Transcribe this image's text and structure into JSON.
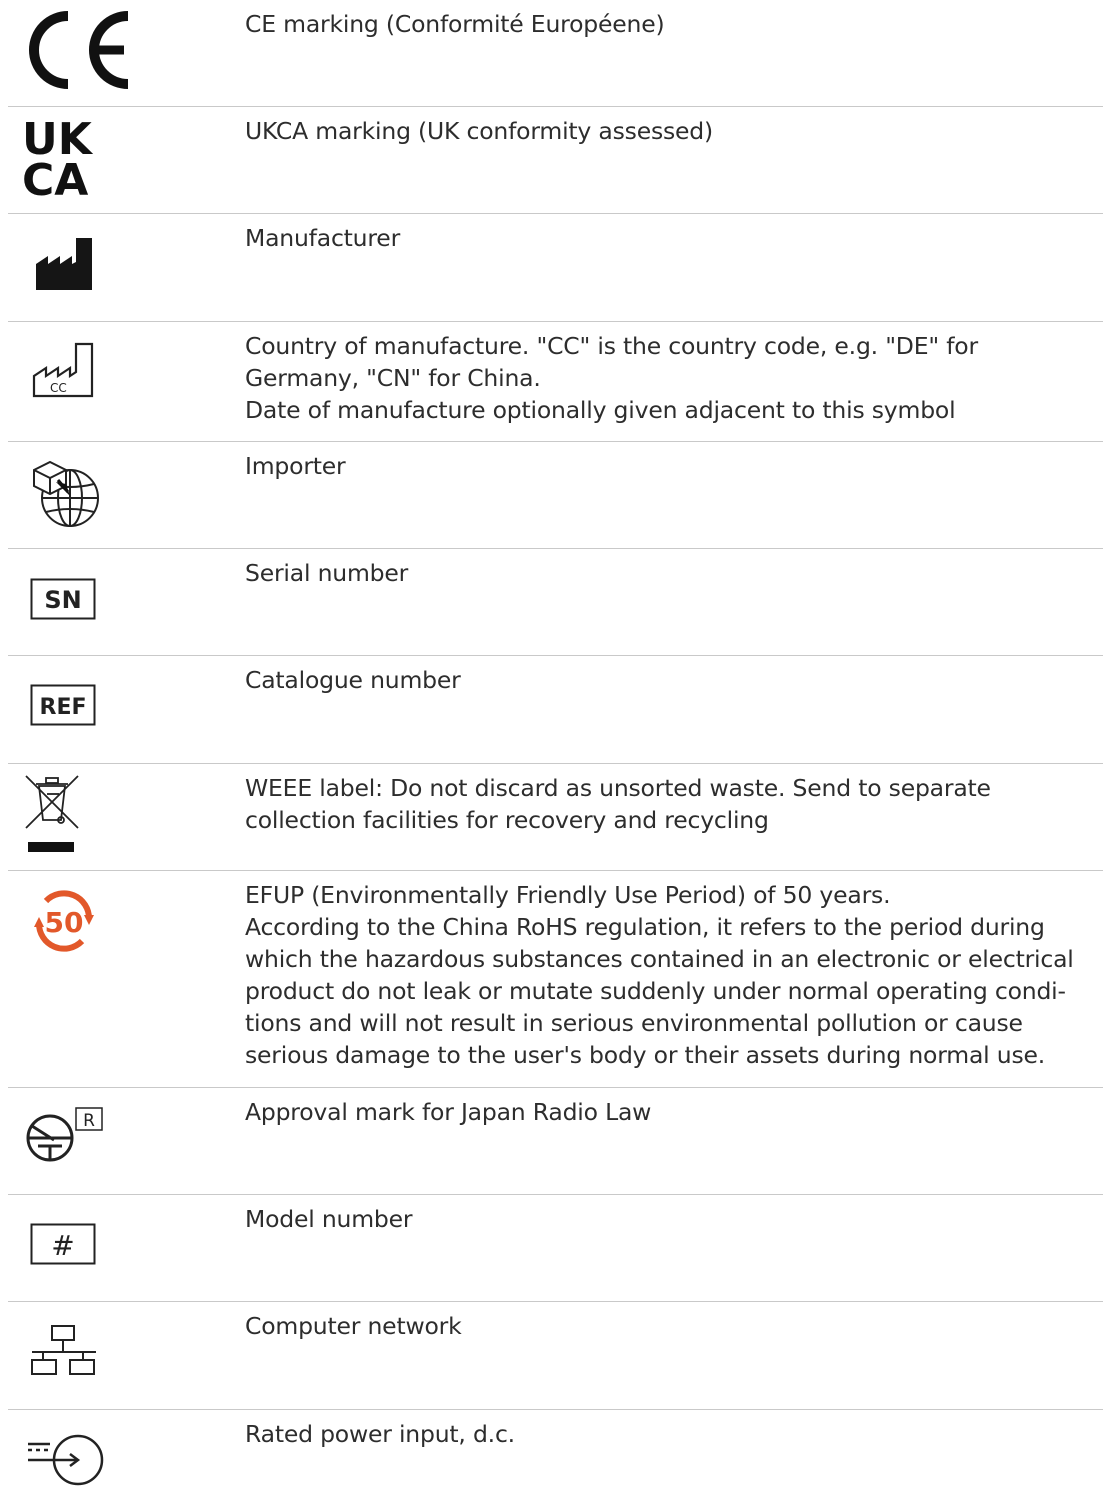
{
  "rows": [
    {
      "icon": "ce-mark-icon",
      "text": "CE marking (Conformité Européene)"
    },
    {
      "icon": "ukca-mark-icon",
      "icon_text": [
        "UK",
        "CA"
      ],
      "text": "UKCA marking (UK conformity assessed)"
    },
    {
      "icon": "manufacturer-factory-icon",
      "text": "Manufacturer"
    },
    {
      "icon": "country-of-manufacture-icon",
      "icon_text": "CC",
      "lines": [
        "Country of manufacture. \"CC\" is the country code, e.g. \"DE\" for Germany, \"CN\" for China.",
        "Date of manufacture optionally given adjacent to this symbol"
      ]
    },
    {
      "icon": "importer-globe-icon",
      "text": "Importer"
    },
    {
      "icon": "serial-number-icon",
      "icon_text": "SN",
      "text": "Serial number"
    },
    {
      "icon": "catalogue-ref-icon",
      "icon_text": "REF",
      "text": "Catalogue number"
    },
    {
      "icon": "weee-crossed-bin-icon",
      "text": "WEEE label: Do not discard as unsorted waste. Send to separate collection facilities for recovery and recycling"
    },
    {
      "icon": "efup-50-icon",
      "icon_text": "50",
      "icon_color": "#e2582a",
      "lines": [
        "EFUP (Environmentally Friendly Use Period) of 50 years.",
        "According to the China RoHS regulation, it refers to the period during which the hazardous substances contained in an electronic or electrical product do not leak or mutate suddenly under normal operating condi-tions and will not result in serious environmental pollution or cause serious damage to the user's body or their assets during normal use."
      ]
    },
    {
      "icon": "japan-radio-law-icon",
      "icon_text": "R",
      "text": "Approval mark for Japan Radio Law"
    },
    {
      "icon": "model-number-icon",
      "icon_text": "#",
      "text": "Model number"
    },
    {
      "icon": "computer-network-icon",
      "text": "Computer network"
    },
    {
      "icon": "dc-power-input-icon",
      "text": "Rated power input, d.c."
    }
  ]
}
